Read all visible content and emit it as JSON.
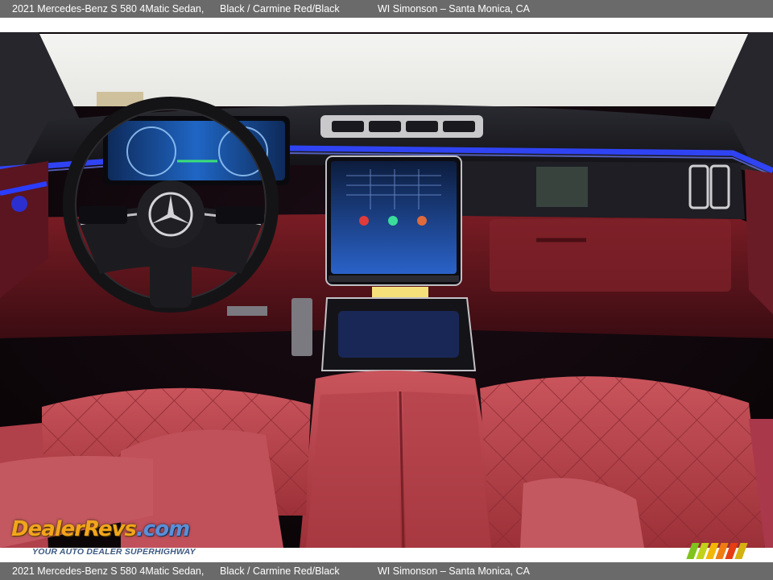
{
  "header": {
    "model": "2021 Mercedes-Benz S 580 4Matic Sedan,",
    "colors": "Black / Carmine Red/Black",
    "dealer": "WI Simonson – Santa Monica, CA"
  },
  "footer": {
    "model": "2021 Mercedes-Benz S 580 4Matic Sedan,",
    "colors": "Black / Carmine Red/Black",
    "dealer": "WI Simonson – Santa Monica, CA"
  },
  "watermark": {
    "logo_part1": "DealerRevs",
    "logo_part2": ".com",
    "tagline": "YOUR AUTO DEALER SUPERHIGHWAY"
  },
  "photo": {
    "subject": "interior-dashboard",
    "colors": {
      "leather": "#b8424c",
      "ambient": "#2a3cff",
      "dash": "#17171c",
      "screen": "#1d4fa8"
    }
  },
  "brand_stripes": [
    "#7fc31c",
    "#c2d21a",
    "#f2b705",
    "#f07d12",
    "#e63d12",
    "#d4b210"
  ]
}
